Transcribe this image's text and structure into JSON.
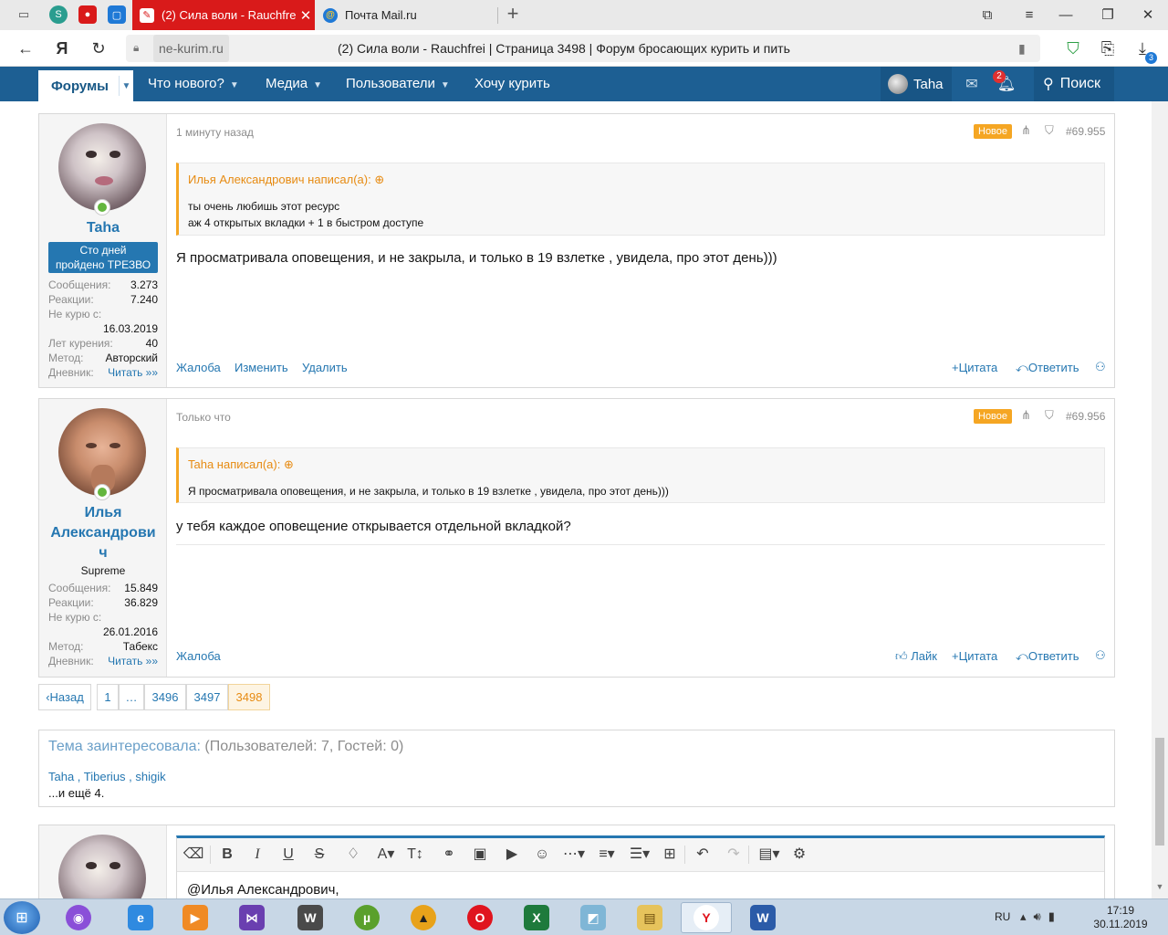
{
  "browser": {
    "tabs": [
      {
        "title": "(2) Сила воли - Rauchfrei",
        "active": true
      },
      {
        "title": "Почта Mail.ru",
        "active": false
      }
    ],
    "new_tab": "+",
    "back": "←",
    "yandex_logo": "Я",
    "url_domain": "ne-kurim.ru",
    "url_title": "(2) Сила воли - Rauchfrei | Страница 3498 | Форум бросающих курить и пить",
    "download_badge": "3"
  },
  "forum_nav": {
    "forums": "Форумы",
    "whats_new": "Что нового?",
    "media": "Медиа",
    "members": "Пользователи",
    "want_smoke": "Хочу курить",
    "user": "Taha",
    "alerts_count": "2",
    "search": "Поиск"
  },
  "posts": [
    {
      "author": "Taha",
      "banner_line1": "Сто дней",
      "banner_line2": "пройдено ТРЕЗВО",
      "stats": {
        "messages_label": "Сообщения:",
        "messages": "3.273",
        "reactions_label": "Реакции:",
        "reactions": "7.240",
        "nosmoke_label": "Не курю с:",
        "nosmoke": "16.03.2019",
        "years_label": "Лет курения:",
        "years": "40",
        "method_label": "Метод:",
        "method": "Авторский",
        "diary_label": "Дневник:",
        "diary": "Читать »»"
      },
      "time": "1 минуту назад",
      "new_badge": "Новое",
      "number": "#69.955",
      "quote_header": "Илья Александрович написал(а):",
      "quote_lines": [
        "ты очень любишь этот ресурс",
        "аж 4 открытых вкладки + 1 в быстром доступе"
      ],
      "message": "Я просматривала оповещения, и не закрыла, и только в 19 взлетке , увидела, про этот день)))",
      "actions_left": [
        "Жалоба",
        "Изменить",
        "Удалить"
      ],
      "quote_action": "Цитата",
      "reply_action": "Ответить"
    },
    {
      "author": "Илья Александрович",
      "author_line1": "Илья",
      "author_line2": "Александрови",
      "author_line3": "ч",
      "user_title": "Supreme",
      "stats": {
        "messages_label": "Сообщения:",
        "messages": "15.849",
        "reactions_label": "Реакции:",
        "reactions": "36.829",
        "nosmoke_label": "Не курю с:",
        "nosmoke": "26.01.2016",
        "method_label": "Метод:",
        "method": "Табекс",
        "diary_label": "Дневник:",
        "diary": "Читать »»"
      },
      "time": "Только что",
      "new_badge": "Новое",
      "number": "#69.956",
      "quote_header": "Taha написал(а):",
      "quote_lines": [
        "Я просматривала оповещения, и не закрыла, и только в 19 взлетке , увидела, про этот день)))"
      ],
      "message": "у тебя каждое оповещение открывается отдельной вкладкой?",
      "actions_left": [
        "Жалоба"
      ],
      "like_action": "Лайк",
      "quote_action": "Цитата",
      "reply_action": "Ответить"
    }
  ],
  "pagination": {
    "prev": "Назад",
    "pages": [
      "1",
      "…",
      "3496",
      "3497",
      "3498"
    ],
    "current": "3498"
  },
  "interested": {
    "title": "Тема заинтересовала:",
    "counts": "(Пользователей: 7, Гостей: 0)",
    "users": "Taha , Tiberius , shigik",
    "more": "...и ещё 4."
  },
  "editor": {
    "text": "@Илья Александрович,"
  },
  "taskbar": {
    "lang": "RU",
    "time": "17:19",
    "date": "30.11.2019"
  },
  "colors": {
    "nav_blue": "#1d5f93",
    "link_blue": "#2577b1",
    "new_orange": "#f5a623",
    "tab_red": "#d91a1a"
  }
}
